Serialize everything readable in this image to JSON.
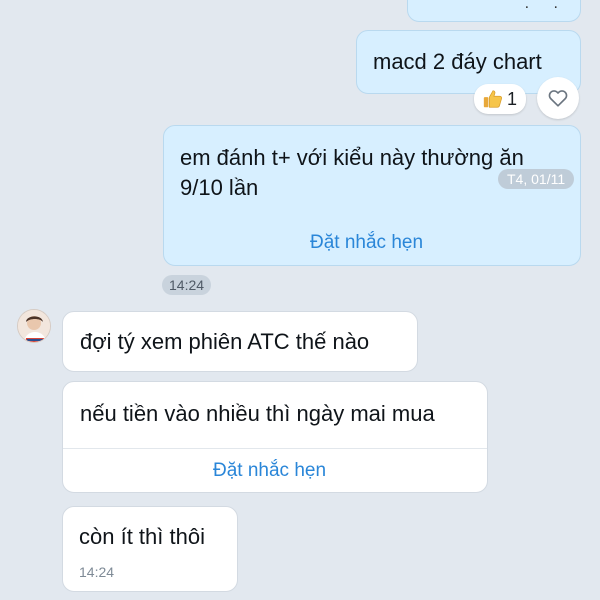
{
  "theme": {
    "background": "#e2e8ef",
    "outgoing_bubble": "#d7efff",
    "incoming_bubble": "#ffffff",
    "link_color": "#2a86d8"
  },
  "messages": {
    "top_partial": {
      "text": ". ."
    },
    "macd": {
      "text": "macd 2 đáy chart",
      "reaction": {
        "icon": "thumbs-up-icon",
        "count": "1"
      },
      "react_icon": "heart-icon"
    },
    "em_danh": {
      "line1": "em đánh t+ với kiểu này thường ăn",
      "line2": "9/10 lần",
      "date": "T4, 01/11",
      "reminder": "Đặt nhắc hẹn"
    },
    "outgoing_time": "14:24",
    "doi_ty": {
      "text": "đợi tý xem phiên ATC thế nào"
    },
    "neu_tien": {
      "text": "nếu tiền vào nhiều thì ngày mai mua",
      "reminder": "Đặt nhắc hẹn"
    },
    "con_it": {
      "text": "còn ít thì thôi",
      "time": "14:24"
    }
  }
}
